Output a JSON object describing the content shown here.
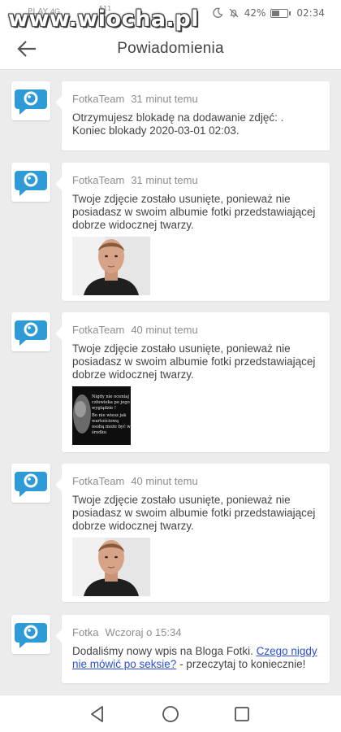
{
  "status_bar": {
    "carrier": "PLAY",
    "signal_text": "4G",
    "speed": "511",
    "battery_percent": "42%",
    "battery_level": 0.42,
    "time": "02:34",
    "icons": [
      "moon-icon",
      "mute-bell-icon",
      "battery-icon"
    ]
  },
  "watermark": {
    "text": "www.wiocha.pl"
  },
  "header": {
    "back_icon": "arrow-left-icon",
    "title": "Powiadomienia"
  },
  "notifications": [
    {
      "sender": "FotkaTeam",
      "time": "31 minut temu",
      "message": "Otrzymujesz blokadę na dodawanie zdjęć: . Koniec blokady 2020-03-01 02:03."
    },
    {
      "sender": "FotkaTeam",
      "time": "31 minut temu",
      "message": "Twoje zdjęcie zostało usunięte, ponieważ nie posiadasz w swoim albumie fotki przedstawiającej dobrze widocznej twarzy.",
      "thumbnail": "portrait-photo"
    },
    {
      "sender": "FotkaTeam",
      "time": "40 minut temu",
      "message": "Twoje zdjęcie zostało usunięte, ponieważ nie posiadasz w swoim albumie fotki przedstawiającej dobrze widocznej twarzy.",
      "thumbnail": "quote-photo",
      "thumbnail_text": "Nigdy nie oceniaj człowieka po jego wyglądzie ! Bo nie wiesz jak wartościowa osobą może być w środku"
    },
    {
      "sender": "FotkaTeam",
      "time": "40 minut temu",
      "message": "Twoje zdjęcie zostało usunięte, ponieważ nie posiadasz w swoim albumie fotki przedstawiającej dobrze widocznej twarzy.",
      "thumbnail": "portrait-photo"
    },
    {
      "sender": "Fotka",
      "time": "Wczoraj o 15:34",
      "message_before": "Dodaliśmy nowy wpis na Bloga Fotki. ",
      "link": "Czego nigdy nie mówić po seksie?",
      "message_after": " - przeczytaj to koniecznie!"
    }
  ],
  "nav_bar": {
    "buttons": [
      "back-triangle-icon",
      "home-circle-icon",
      "recents-square-icon"
    ]
  },
  "colors": {
    "accent_logo": "#2e9bd6",
    "background": "#ececec",
    "link": "#2a4fd6"
  }
}
